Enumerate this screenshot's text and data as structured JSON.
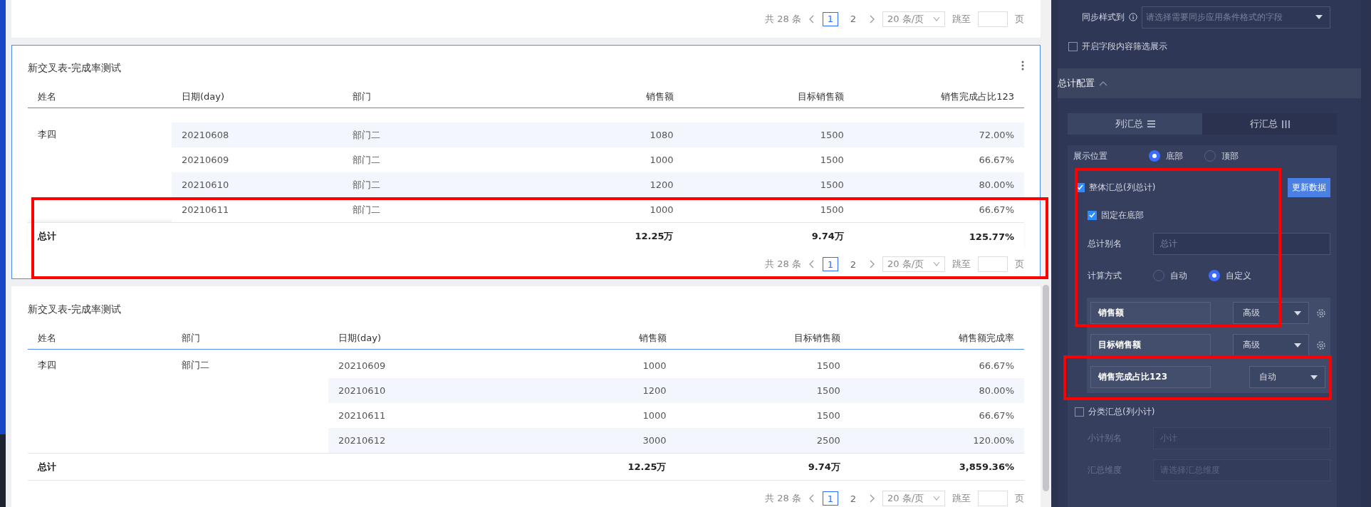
{
  "cards": [
    {
      "kind": "pager",
      "pagination": {
        "total": "共 28 条",
        "pages": [
          {
            "label": "1",
            "selected": true
          },
          {
            "label": "2",
            "selected": false
          }
        ],
        "page_size": "20 条/页",
        "jump_label": "跳至",
        "page_suffix": "页"
      }
    },
    {
      "kind": "table",
      "title": "新交叉表-完成率测试",
      "focused": true,
      "table": {
        "columns": [
          "姓名",
          "日期(day)",
          "部门",
          "销售额",
          "目标销售额",
          "销售完成占比123"
        ],
        "rows": [
          {
            "cells": [
              "李四",
              "20210608",
              "部门二",
              "1080",
              "1500",
              "72.00%"
            ],
            "shaded": true
          },
          {
            "cells": [
              "",
              "20210609",
              "部门二",
              "1000",
              "1500",
              "66.67%"
            ],
            "shaded": false
          },
          {
            "cells": [
              "",
              "20210610",
              "部门二",
              "1200",
              "1500",
              "80.00%"
            ],
            "shaded": true
          },
          {
            "cells": [
              "",
              "20210611",
              "部门二",
              "1000",
              "1500",
              "66.67%"
            ],
            "shaded": false
          }
        ],
        "total": {
          "label": "总计",
          "values": [
            "12.25万",
            "9.74万",
            "125.77%"
          ]
        }
      },
      "pagination": {
        "total": "共 28 条",
        "pages": [
          {
            "label": "1",
            "selected": true
          },
          {
            "label": "2",
            "selected": false
          }
        ],
        "page_size": "20 条/页",
        "jump_label": "跳至",
        "page_suffix": "页"
      }
    },
    {
      "kind": "table",
      "title": "新交叉表-完成率测试",
      "focused": false,
      "table": {
        "columns": [
          "姓名",
          "部门",
          "日期(day)",
          "销售额",
          "目标销售额",
          "销售额完成率"
        ],
        "rows": [
          {
            "cells": [
              "李四",
              "部门二",
              "20210609",
              "1000",
              "1500",
              "66.67%"
            ],
            "shaded": false
          },
          {
            "cells": [
              "",
              "",
              "20210610",
              "1200",
              "1500",
              "80.00%"
            ],
            "shaded": true
          },
          {
            "cells": [
              "",
              "",
              "20210611",
              "1000",
              "1500",
              "66.67%"
            ],
            "shaded": false
          },
          {
            "cells": [
              "",
              "",
              "20210612",
              "3000",
              "2500",
              "120.00%"
            ],
            "shaded": true
          }
        ],
        "total": {
          "label": "总计",
          "values": [
            "12.25万",
            "9.74万",
            "3,859.36%"
          ]
        }
      },
      "pagination": {
        "total": "共 28 条",
        "pages": [
          {
            "label": "1",
            "selected": true
          },
          {
            "label": "2",
            "selected": false
          }
        ],
        "page_size": "20 条/页",
        "jump_label": "跳至",
        "page_suffix": "页"
      }
    }
  ],
  "settings": {
    "sync_style": {
      "label": "同步样式到",
      "placeholder": "请选择需要同步应用条件格式的字段"
    },
    "filter_display": {
      "label": "开启字段内容筛选展示",
      "checked": false
    },
    "section": {
      "title": "总计配置",
      "expanded": true
    },
    "tabs": [
      {
        "label": "列汇总",
        "selected": true
      },
      {
        "label": "行汇总",
        "selected": false
      }
    ],
    "position": {
      "label": "展示位置",
      "options": [
        {
          "label": "底部",
          "selected": true
        },
        {
          "label": "顶部",
          "selected": false
        }
      ]
    },
    "grand_total": {
      "label": "整体汇总(列总计)",
      "checked": true,
      "button": "更新数据"
    },
    "pin_bottom": {
      "label": "固定在底部",
      "checked": true
    },
    "alias": {
      "label": "总计别名",
      "placeholder": "总计"
    },
    "method": {
      "label": "计算方式",
      "options": [
        {
          "label": "自动",
          "selected": false
        },
        {
          "label": "自定义",
          "selected": true
        }
      ]
    },
    "fields": [
      {
        "name": "销售额",
        "mode": "高级",
        "configurable": true
      },
      {
        "name": "目标销售额",
        "mode": "高级",
        "configurable": true
      },
      {
        "name": "销售完成占比123",
        "mode": "自动",
        "configurable": false
      }
    ],
    "subtotal": {
      "label": "分类汇总(列小计)",
      "checked": false
    },
    "subtotal_inputs": [
      {
        "label": "小计别名",
        "placeholder": "小计",
        "disabled": true
      },
      {
        "label": "汇总维度",
        "placeholder": "请选择汇总维度",
        "disabled": true
      }
    ]
  }
}
